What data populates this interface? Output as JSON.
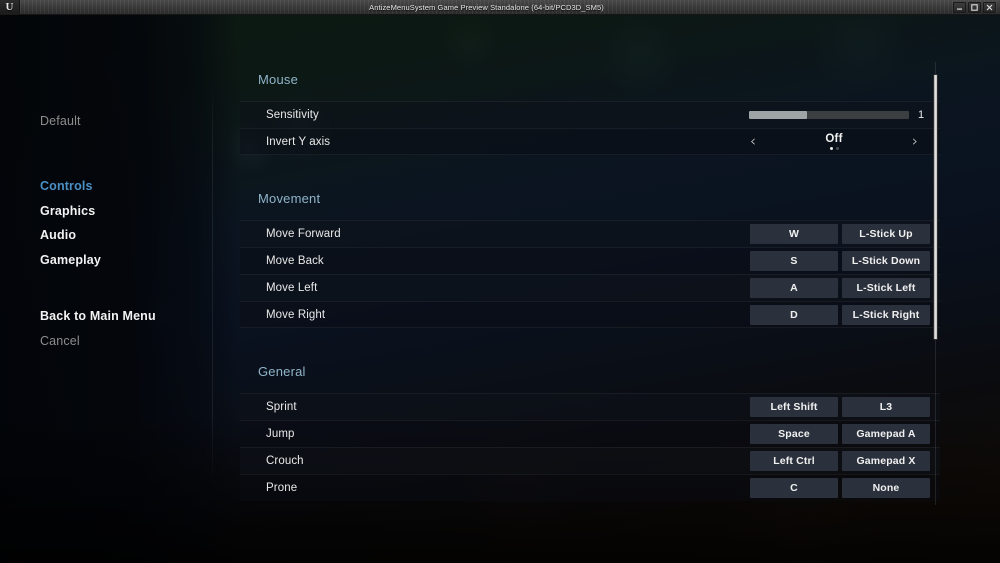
{
  "window": {
    "title": "AntizeMenuSystem Game Preview Standalone (64-bit/PCD3D_SM5)",
    "logo_glyph": "U",
    "controls": {
      "minimize_label": "Minimize",
      "maximize_label": "Maximize",
      "close_label": "Close"
    }
  },
  "sidebar": {
    "top_action": {
      "label": "Default",
      "state": "muted"
    },
    "tabs": [
      {
        "label": "Controls",
        "state": "active"
      },
      {
        "label": "Graphics",
        "state": "normal"
      },
      {
        "label": "Audio",
        "state": "normal"
      },
      {
        "label": "Gameplay",
        "state": "normal"
      }
    ],
    "bottom_actions": [
      {
        "label": "Back to Main Menu",
        "state": "normal"
      },
      {
        "label": "Cancel",
        "state": "muted"
      }
    ]
  },
  "settings": {
    "sections": [
      {
        "title": "Mouse",
        "rows": [
          {
            "label": "Sensitivity",
            "type": "slider",
            "value": "1",
            "fill_percent": 36
          },
          {
            "label": "Invert Y axis",
            "type": "selector",
            "value": "Off",
            "prev_glyph": "‹",
            "next_glyph": "›",
            "dot_count": 2,
            "dot_active_index": 0
          }
        ]
      },
      {
        "title": "Movement",
        "rows": [
          {
            "label": "Move Forward",
            "type": "binding",
            "key": "W",
            "pad": "L-Stick Up"
          },
          {
            "label": "Move Back",
            "type": "binding",
            "key": "S",
            "pad": "L-Stick Down"
          },
          {
            "label": "Move Left",
            "type": "binding",
            "key": "A",
            "pad": "L-Stick Left"
          },
          {
            "label": "Move Right",
            "type": "binding",
            "key": "D",
            "pad": "L-Stick Right"
          }
        ]
      },
      {
        "title": "General",
        "rows": [
          {
            "label": "Sprint",
            "type": "binding",
            "key": "Left Shift",
            "pad": "L3"
          },
          {
            "label": "Jump",
            "type": "binding",
            "key": "Space",
            "pad": "Gamepad A"
          },
          {
            "label": "Crouch",
            "type": "binding",
            "key": "Left Ctrl",
            "pad": "Gamepad X"
          },
          {
            "label": "Prone",
            "type": "binding",
            "key": "C",
            "pad": "None"
          }
        ]
      }
    ]
  },
  "scrollbar": {
    "thumb_top_percent": 2.7,
    "thumb_height_percent": 60
  },
  "colors": {
    "accent": "#4a90c4",
    "section_title": "#8fb4c9",
    "binding_button": "#2b313c",
    "slider_fill": "#9fa5a7",
    "slider_track": "#3b3f42"
  }
}
